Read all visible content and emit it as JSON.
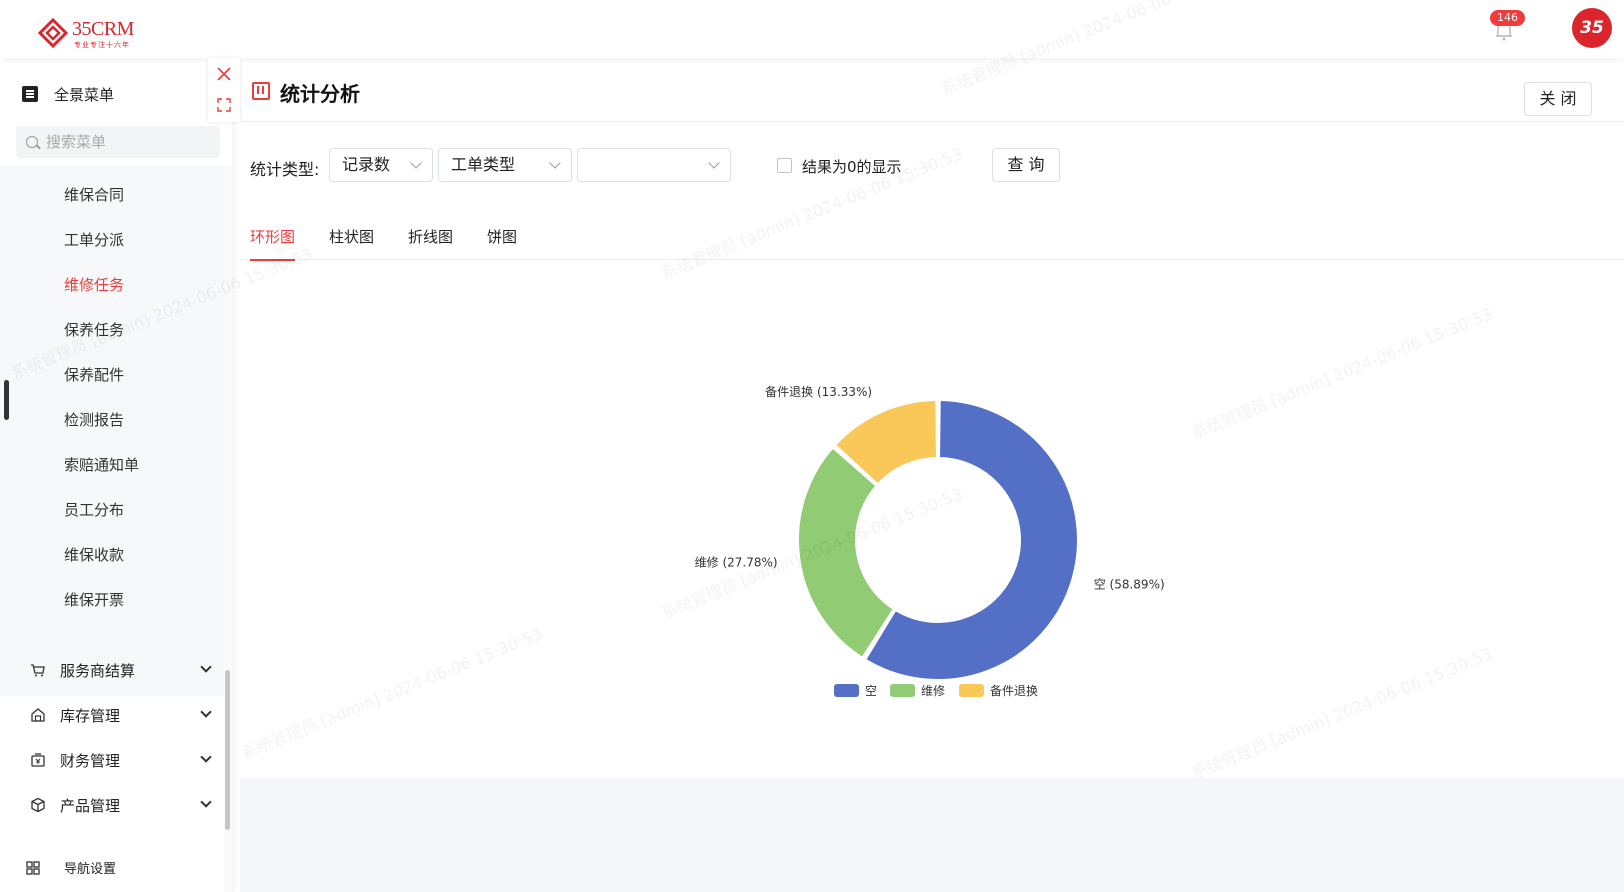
{
  "header": {
    "logo_text": "35CRM",
    "logo_sub": "专业专注十六年",
    "notification_count": "146",
    "avatar_text": "35",
    "accent_color": "#f03b3b"
  },
  "sidebar": {
    "head_label": "全景菜单",
    "search_placeholder": "搜索菜单",
    "sub_items": [
      {
        "label": "维保合同"
      },
      {
        "label": "工单分派"
      },
      {
        "label": "维修任务",
        "active": true
      },
      {
        "label": "保养任务"
      },
      {
        "label": "保养配件"
      },
      {
        "label": "检测报告"
      },
      {
        "label": "索赔通知单"
      },
      {
        "label": "员工分布"
      },
      {
        "label": "维保收款"
      },
      {
        "label": "维保开票"
      }
    ],
    "groups": [
      {
        "label": "服务商结算",
        "icon": "cart-icon"
      },
      {
        "label": "库存管理",
        "icon": "warehouse-icon"
      },
      {
        "label": "财务管理",
        "icon": "finance-icon"
      },
      {
        "label": "产品管理",
        "icon": "box-icon"
      }
    ],
    "nav_setting_label": "导航设置"
  },
  "panel": {
    "title": "统计分析",
    "close_label": "关 闭",
    "filter_label": "统计类型:",
    "select1": "记录数",
    "select2": "工单类型",
    "select3": "",
    "checkbox_label": "结果为0的显示",
    "query_label": "查 询",
    "tabs": [
      {
        "label": "环形图",
        "active": true
      },
      {
        "label": "柱状图"
      },
      {
        "label": "折线图"
      },
      {
        "label": "饼图"
      }
    ]
  },
  "chart_data": {
    "type": "pie",
    "variant": "donut",
    "slices": [
      {
        "name": "空",
        "percent": 58.89,
        "label": "空 (58.89%)",
        "color": "#5470c6"
      },
      {
        "name": "维修",
        "percent": 27.78,
        "label": "维修 (27.78%)",
        "color": "#91cc75"
      },
      {
        "name": "备件退换",
        "percent": 13.33,
        "label": "备件退换 (13.33%)",
        "color": "#fac858"
      }
    ],
    "legend": [
      "空",
      "维修",
      "备件退换"
    ],
    "legend_position": "bottom-center"
  },
  "watermark": "系统管理员 [admin] 2024-06-06 15:30:53"
}
